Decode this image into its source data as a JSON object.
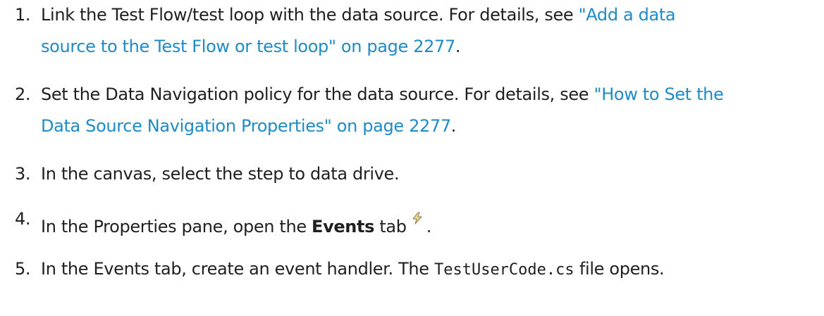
{
  "steps": [
    {
      "number": "1.",
      "text_before": "Link the Test Flow/test loop with the data source. For details, see ",
      "link_part1": "\"Add a data",
      "link_part2": "source to the Test Flow or test loop\" on page 2277",
      "text_after": "."
    },
    {
      "number": "2.",
      "text_before": "Set the Data Navigation policy for the data source. For details, see ",
      "link_part1": "\"How to Set the",
      "link_part2": "Data Source Navigation Properties\" on page 2277",
      "text_after": "."
    },
    {
      "number": "3.",
      "text": "In the canvas, select the step to data drive."
    },
    {
      "number": "4.",
      "text_before": "In the Properties pane, open the ",
      "bold": "Events",
      "text_after": " tab",
      "icon": "lightning-bolt-icon",
      "trailing": "."
    },
    {
      "number": "5.",
      "text_before": "In the Events tab, create an event handler. The ",
      "code": "TestUserCode.cs",
      "text_after": " file opens."
    }
  ],
  "colors": {
    "text": "#1f1f1f",
    "link": "#1d8bc7",
    "icon_fill": "#e8d9a0",
    "icon_stroke": "#8a7a3a"
  }
}
